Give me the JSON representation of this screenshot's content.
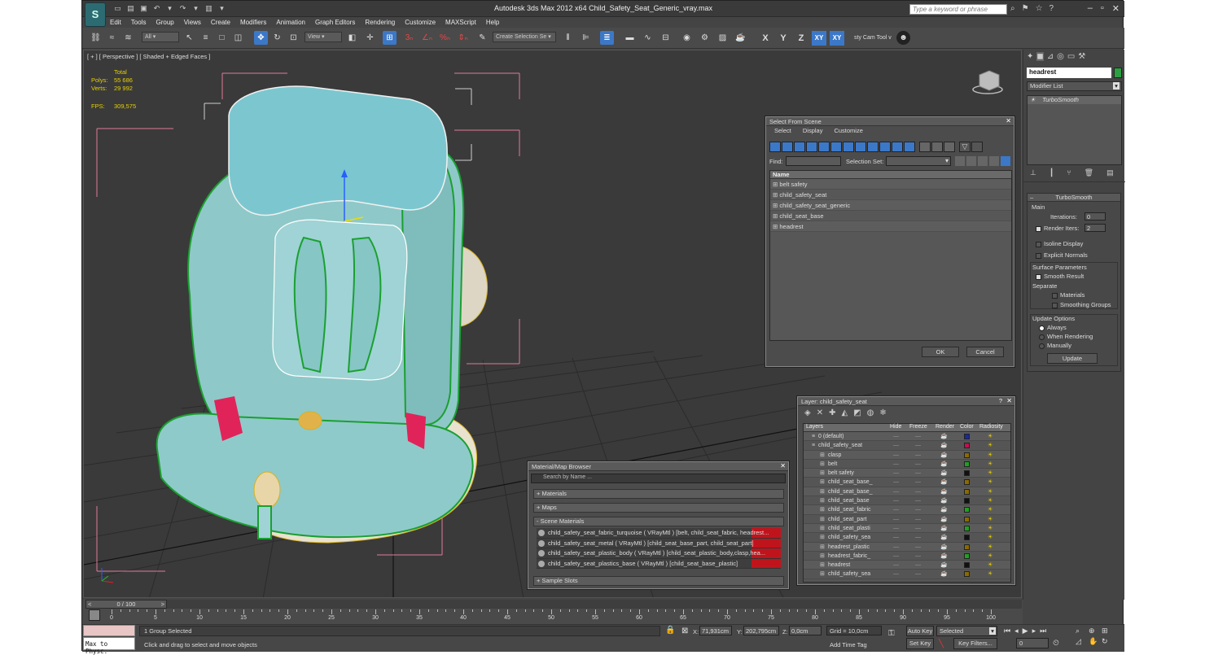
{
  "app": {
    "logo_text": "S",
    "title": "Autodesk 3ds Max  2012 x64      Child_Safety_Seat_Generic_vray.max",
    "search_placeholder": "Type a keyword or phrase"
  },
  "menu": [
    "Edit",
    "Tools",
    "Group",
    "Views",
    "Create",
    "Modifiers",
    "Animation",
    "Graph Editors",
    "Rendering",
    "Customize",
    "MAXScript",
    "Help"
  ],
  "toolbar": {
    "filter_value": "All",
    "refcoord_value": "View",
    "selection_set_placeholder": "Create Selection Se",
    "axes": [
      "X",
      "Y",
      "Z",
      "XY",
      "XY"
    ],
    "camtool_label": "sty Cam Tool v"
  },
  "viewport": {
    "label": "[ + ] [ Perspective ] [ Shaded + Edged Faces ]",
    "stats_header": "Total",
    "polys_label": "Polys:",
    "polys_value": "55 686",
    "verts_label": "Verts:",
    "verts_value": "29 992",
    "fps_label": "FPS:",
    "fps_value": "309,575"
  },
  "select_from_scene": {
    "title": "Select From Scene",
    "menu": [
      "Select",
      "Display",
      "Customize"
    ],
    "find_label": "Find:",
    "selection_set_label": "Selection Set:",
    "column": "Name",
    "items": [
      "belt safety",
      "child_safety_seat",
      "child_safety_seat_generic",
      "child_seat_base",
      "headrest"
    ],
    "ok": "OK",
    "cancel": "Cancel"
  },
  "layer_dialog": {
    "title": "Layer: child_safety_seat",
    "help": "?",
    "columns": [
      "Layers",
      "Hide",
      "Freeze",
      "Render",
      "Color",
      "Radiosity"
    ],
    "rows": [
      {
        "name": "0 (default)",
        "indent": 0,
        "color": "#1a2a9a"
      },
      {
        "name": "child_safety_seat",
        "indent": 0,
        "color": "#c01050"
      },
      {
        "name": "clasp",
        "indent": 1,
        "color": "#8a6a00"
      },
      {
        "name": "belt",
        "indent": 1,
        "color": "#20a020"
      },
      {
        "name": "belt safety",
        "indent": 1,
        "color": "#111111"
      },
      {
        "name": "child_seat_base_",
        "indent": 1,
        "color": "#8a6a00"
      },
      {
        "name": "child_seat_base_",
        "indent": 1,
        "color": "#8a6a00"
      },
      {
        "name": "child_seat_base",
        "indent": 1,
        "color": "#111111"
      },
      {
        "name": "child_seat_fabric",
        "indent": 1,
        "color": "#20a020"
      },
      {
        "name": "child_seat_part",
        "indent": 1,
        "color": "#8a6a00"
      },
      {
        "name": "child_seat_plasti",
        "indent": 1,
        "color": "#20a020"
      },
      {
        "name": "child_safety_sea",
        "indent": 1,
        "color": "#111111"
      },
      {
        "name": "headrest_plastic",
        "indent": 1,
        "color": "#8a6a00"
      },
      {
        "name": "headrest_fabric_",
        "indent": 1,
        "color": "#20a020"
      },
      {
        "name": "headrest",
        "indent": 1,
        "color": "#111111"
      },
      {
        "name": "child_safety_sea",
        "indent": 1,
        "color": "#8a6a00"
      }
    ]
  },
  "material_browser": {
    "title": "Material/Map Browser",
    "search_placeholder": "Search by Name ...",
    "groups": [
      "+ Materials",
      "+ Maps",
      "- Scene Materials"
    ],
    "materials": [
      "child_safety_seat_fabric_turquoise ( VRayMtl ) [belt, child_seat_fabric, headrest...",
      "child_safety_seat_metal  ( VRayMtl ) [child_seat_base_part, child_seat_part]",
      "child_safety_seat_plastic_body ( VRayMtl ) [child_seat_plastic_body,clasp,hea...",
      "child_safety_seat_plastics_base ( VRayMtl ) [child_seat_base_plastic]"
    ],
    "sample_slots": "+ Sample Slots"
  },
  "command_panel": {
    "object_name": "headrest",
    "modifier_list": "Modifier List",
    "modifier": "TurboSmooth",
    "rollout_title": "TurboSmooth",
    "main_label": "Main",
    "iterations_label": "Iterations:",
    "iterations_value": "0",
    "render_iters_label": "Render Iters:",
    "render_iters_value": "2",
    "isoline": "Isoline Display",
    "explicit": "Explicit Normals",
    "surface_params": "Surface Parameters",
    "smooth_result": "Smooth Result",
    "separate": "Separate",
    "materials": "Materials",
    "smoothing_groups": "Smoothing Groups",
    "update_options": "Update Options",
    "always": "Always",
    "when_rendering": "When Rendering",
    "manually": "Manually",
    "update_btn": "Update"
  },
  "timeline": {
    "frame_label": "0 / 100",
    "ticks": [
      "0",
      "5",
      "10",
      "15",
      "20",
      "25",
      "30",
      "35",
      "40",
      "45",
      "50",
      "55",
      "60",
      "65",
      "70",
      "75",
      "80",
      "85",
      "90",
      "95",
      "100"
    ]
  },
  "status": {
    "maxscript": "Max to Physc.",
    "selected": "1 Group Selected",
    "prompt": "Click and drag to select and move objects",
    "x_label": "X:",
    "x_value": "71,931cm",
    "y_label": "Y:",
    "y_value": "202,795cm",
    "z_label": "Z:",
    "z_value": "0,0cm",
    "grid": "Grid = 10,0cm",
    "add_time_tag": "Add Time Tag",
    "auto_key": "Auto Key",
    "set_key": "Set Key",
    "selected_dd": "Selected",
    "key_filters": "Key Filters...",
    "frame_value": "0"
  }
}
